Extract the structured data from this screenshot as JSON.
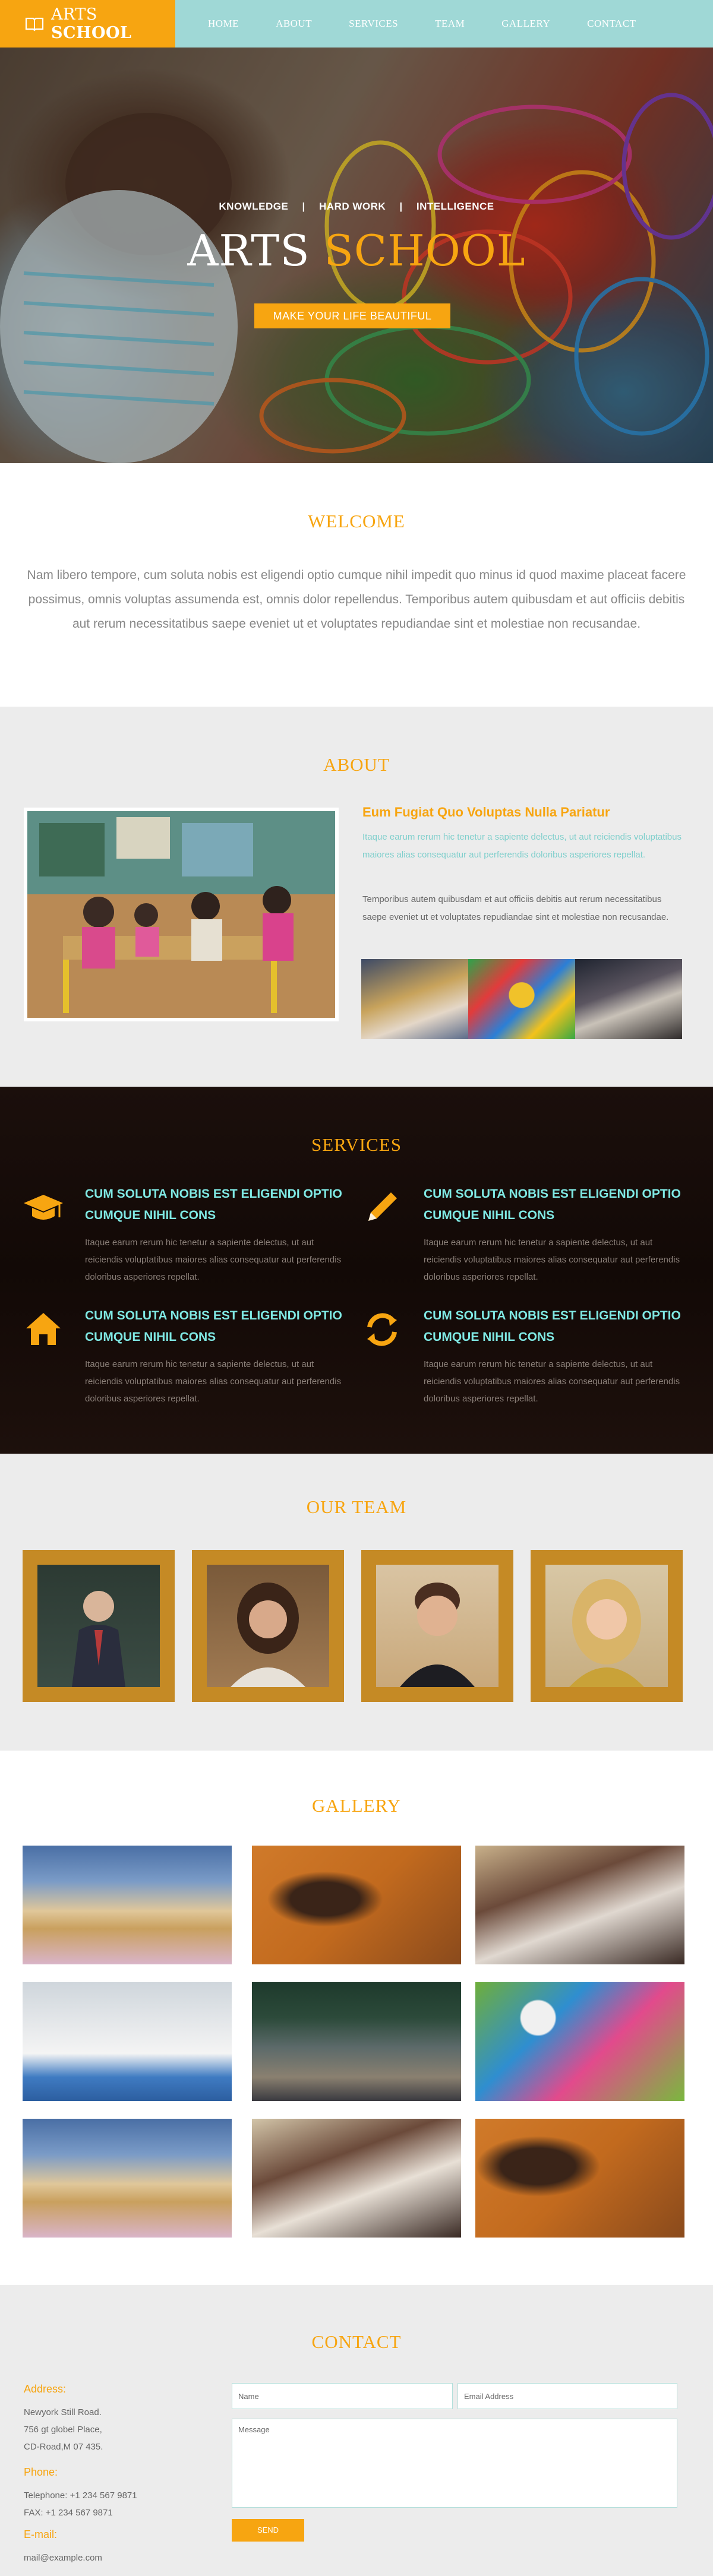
{
  "brand": {
    "name_part1": "ARTS",
    "name_part2": "SCHOOL",
    "accent": "#f7a511",
    "nav_bg": "#9fd8d6"
  },
  "nav": {
    "items": [
      "HOME",
      "ABOUT",
      "SERVICES",
      "TEAM",
      "GALLERY",
      "CONTACT"
    ]
  },
  "hero": {
    "tag1": "KNOWLEDGE",
    "tag2": "HARD WORK",
    "tag3": "INTELLIGENCE",
    "separator": "|",
    "title_part1": "ARTS",
    "title_part2": "SCHOOL",
    "button": "MAKE YOUR LIFE BEAUTIFUL"
  },
  "welcome": {
    "title": "WELCOME",
    "text": "Nam libero tempore, cum soluta nobis est eligendi optio cumque nihil impedit quo minus id quod maxime placeat facere possimus, omnis voluptas assumenda est, omnis dolor repellendus. Temporibus autem quibusdam et aut officiis debitis aut rerum necessitatibus saepe eveniet ut et voluptates repudiandae sint et molestiae non recusandae."
  },
  "about": {
    "title": "ABOUT",
    "heading": "Eum Fugiat Quo Voluptas Nulla Pariatur",
    "highlight": "Itaque earum rerum hic tenetur a sapiente delectus, ut aut reiciendis voluptatibus maiores alias consequatur aut perferendis doloribus asperiores repellat.",
    "text": "Temporibus autem quibusdam et aut officiis debitis aut rerum necessitatibus saepe eveniet ut et voluptates repudiandae sint et molestiae non recusandae."
  },
  "services": {
    "title": "SERVICES",
    "items": [
      {
        "icon": "graduation-cap-icon",
        "title": "CUM SOLUTA NOBIS EST ELIGENDI OPTIO CUMQUE NIHIL CONS",
        "text": "Itaque earum rerum hic tenetur a sapiente delectus, ut aut reiciendis voluptatibus maiores alias consequatur aut perferendis doloribus asperiores repellat."
      },
      {
        "icon": "pencil-icon",
        "title": "CUM SOLUTA NOBIS EST ELIGENDI OPTIO CUMQUE NIHIL CONS",
        "text": "Itaque earum rerum hic tenetur a sapiente delectus, ut aut reiciendis voluptatibus maiores alias consequatur aut perferendis doloribus asperiores repellat."
      },
      {
        "icon": "home-icon",
        "title": "CUM SOLUTA NOBIS EST ELIGENDI OPTIO CUMQUE NIHIL CONS",
        "text": "Itaque earum rerum hic tenetur a sapiente delectus, ut aut reiciendis voluptatibus maiores alias consequatur aut perferendis doloribus asperiores repellat."
      },
      {
        "icon": "refresh-icon",
        "title": "CUM SOLUTA NOBIS EST ELIGENDI OPTIO CUMQUE NIHIL CONS",
        "text": "Itaque earum rerum hic tenetur a sapiente delectus, ut aut reiciendis voluptatibus maiores alias consequatur aut perferendis doloribus asperiores repellat."
      }
    ]
  },
  "team": {
    "title": "OUR TEAM"
  },
  "gallery": {
    "title": "GALLERY"
  },
  "contact": {
    "title": "CONTACT",
    "address_label": "Address:",
    "address_lines": [
      "Newyork Still Road.",
      "756 gt globel Place,",
      "CD-Road,M 07 435."
    ],
    "phone_label": "Phone:",
    "phone_lines": [
      "Telephone: +1 234 567 9871",
      "FAX: +1 234 567 9871"
    ],
    "email_label": "E-mail:",
    "email": "mail@example.com",
    "name_placeholder": "Name",
    "email_placeholder": "Email Address",
    "message_placeholder": "Message",
    "send": "SEND"
  }
}
